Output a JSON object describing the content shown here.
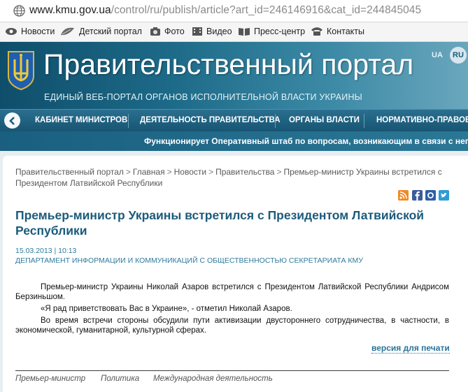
{
  "browser": {
    "url_host": "www.kmu.gov.ua",
    "url_path": "/control/ru/publish/article?art_id=246146916&cat_id=244845045"
  },
  "bookmarks": [
    {
      "label": "Новости",
      "icon": "eye-icon"
    },
    {
      "label": "Детский портал",
      "icon": "leaf-icon"
    },
    {
      "label": "Фото",
      "icon": "camera-icon"
    },
    {
      "label": "Видео",
      "icon": "film-icon"
    },
    {
      "label": "Пресс-центр",
      "icon": "book-icon"
    },
    {
      "label": "Контакты",
      "icon": "phone-icon"
    }
  ],
  "header": {
    "title": "Правительственный портал",
    "subtitle": "ЕДИНЫЙ ВЕБ-ПОРТАЛ ОРГАНОВ ИСПОЛНИТЕЛЬНОЙ ВЛАСТИ УКРАИНЫ",
    "lang_ua": "UA",
    "lang_ru": "RU"
  },
  "nav": {
    "items": [
      "КАБИНЕТ МИНИСТРОВ",
      "ДЕЯТЕЛЬНОСТЬ ПРАВИТЕЛЬСТВА",
      "ОРГАНЫ ВЛАСТИ",
      "НОРМАТИВНО-ПРАВОВАЯ"
    ]
  },
  "ticker": {
    "text": "Функционирует Оперативный штаб по вопросам, возникающим в связи с непогод"
  },
  "breadcrumb": {
    "items": [
      "Правительственный портал",
      "Главная",
      "Новости",
      "Правительства",
      "Премьер-министр Украины встретился с Президентом Латвийской Республики"
    ]
  },
  "article": {
    "title": "Премьер-министр Украины встретился с Президентом Латвийской Республики",
    "date": "15.03.2013 | 10:13",
    "department": "ДЕПАРТАМЕНТ ИНФОРМАЦИИ И КОММУНИКАЦИЙ С ОБЩЕСТВЕННОСТЬЮ СЕКРЕТАРИАТА КМУ",
    "paragraphs": [
      "Премьер-министр Украины Николай Азаров встретился с Президентом Латвийской Республики Андрисом Берзиньшом.",
      "«Я рад приветствовать Вас в Украине», - отметил Николай Азаров.",
      "Во время встречи стороны обсудили пути активизации двустороннего сотрудничества, в частности, в экономической, гуманитарной, культурной сферах."
    ],
    "print_label": "версия для печати",
    "tags": [
      "Премьер-министр",
      "Политика",
      "Международная деятельность"
    ]
  },
  "colors": {
    "header_dark": "#0f4e6b",
    "title_blue": "#1b5b7c",
    "link_blue": "#2a7398"
  }
}
